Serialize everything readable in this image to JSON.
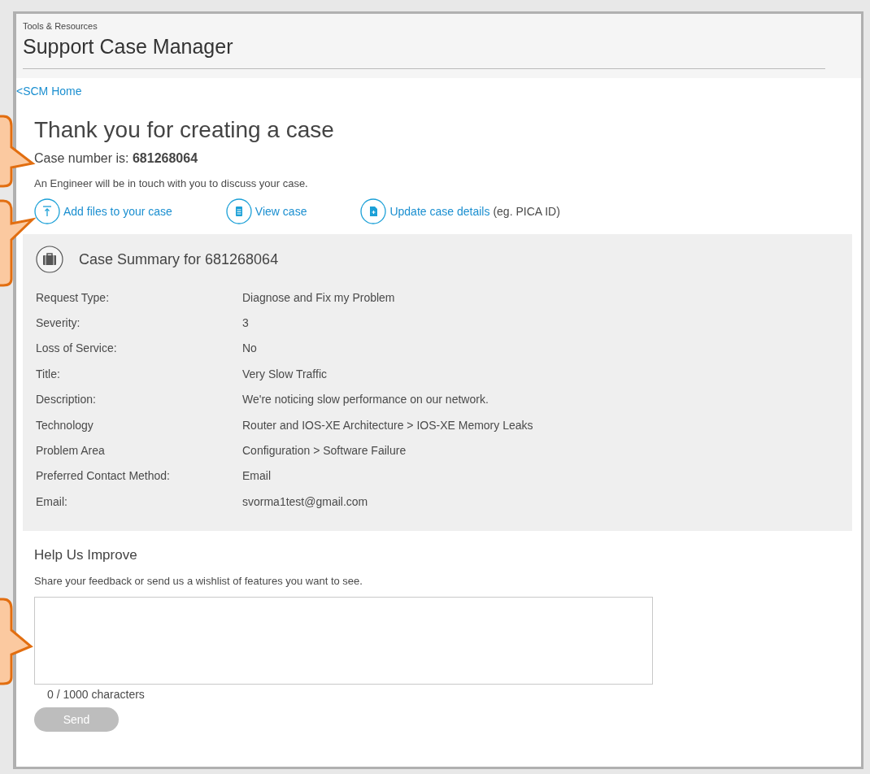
{
  "header": {
    "breadcrumb": "Tools & Resources",
    "title": "Support Case Manager"
  },
  "back_link": "<SCM Home",
  "heading": "Thank you for creating a case",
  "case_number": "Case number is: **681268064**",
  "message": "An Engineer will be in touch with you to discuss your case.",
  "actions": [
    {
      "kind": "upload",
      "label": "Add files to your case"
    },
    {
      "kind": "document",
      "label": "View case"
    },
    {
      "kind": "add-document",
      "label": "Update case details",
      "note": "(eg. PICA ID)"
    }
  ],
  "summary": {
    "title": "Case Summary for 681268064",
    "rows": [
      {
        "label": "Request Type:",
        "value": "Diagnose and Fix my Problem"
      },
      {
        "label": "Severity:",
        "value": "3"
      },
      {
        "label": "Loss of Service:",
        "value": "No"
      },
      {
        "label": "Title:",
        "value": "Very Slow Traffic"
      },
      {
        "label": "Description:",
        "value": "We're noticing slow performance on our network."
      },
      {
        "label": "Technology",
        "value": "Router and IOS-XE Architecture > IOS-XE Memory Leaks"
      },
      {
        "label": "Problem Area",
        "value": "Configuration > Software Failure"
      },
      {
        "label": "Preferred Contact Method:",
        "value": "Email"
      },
      {
        "label": "Email:",
        "value": "svorma1test@gmail.com"
      }
    ]
  },
  "feedback": {
    "title": "Help Us Improve",
    "description": "Share your feedback or send us a wishlist of features you want to see.",
    "counter": "0 / 1000 characters",
    "send_button": {
      "label": "Send",
      "disabled": true
    }
  }
}
